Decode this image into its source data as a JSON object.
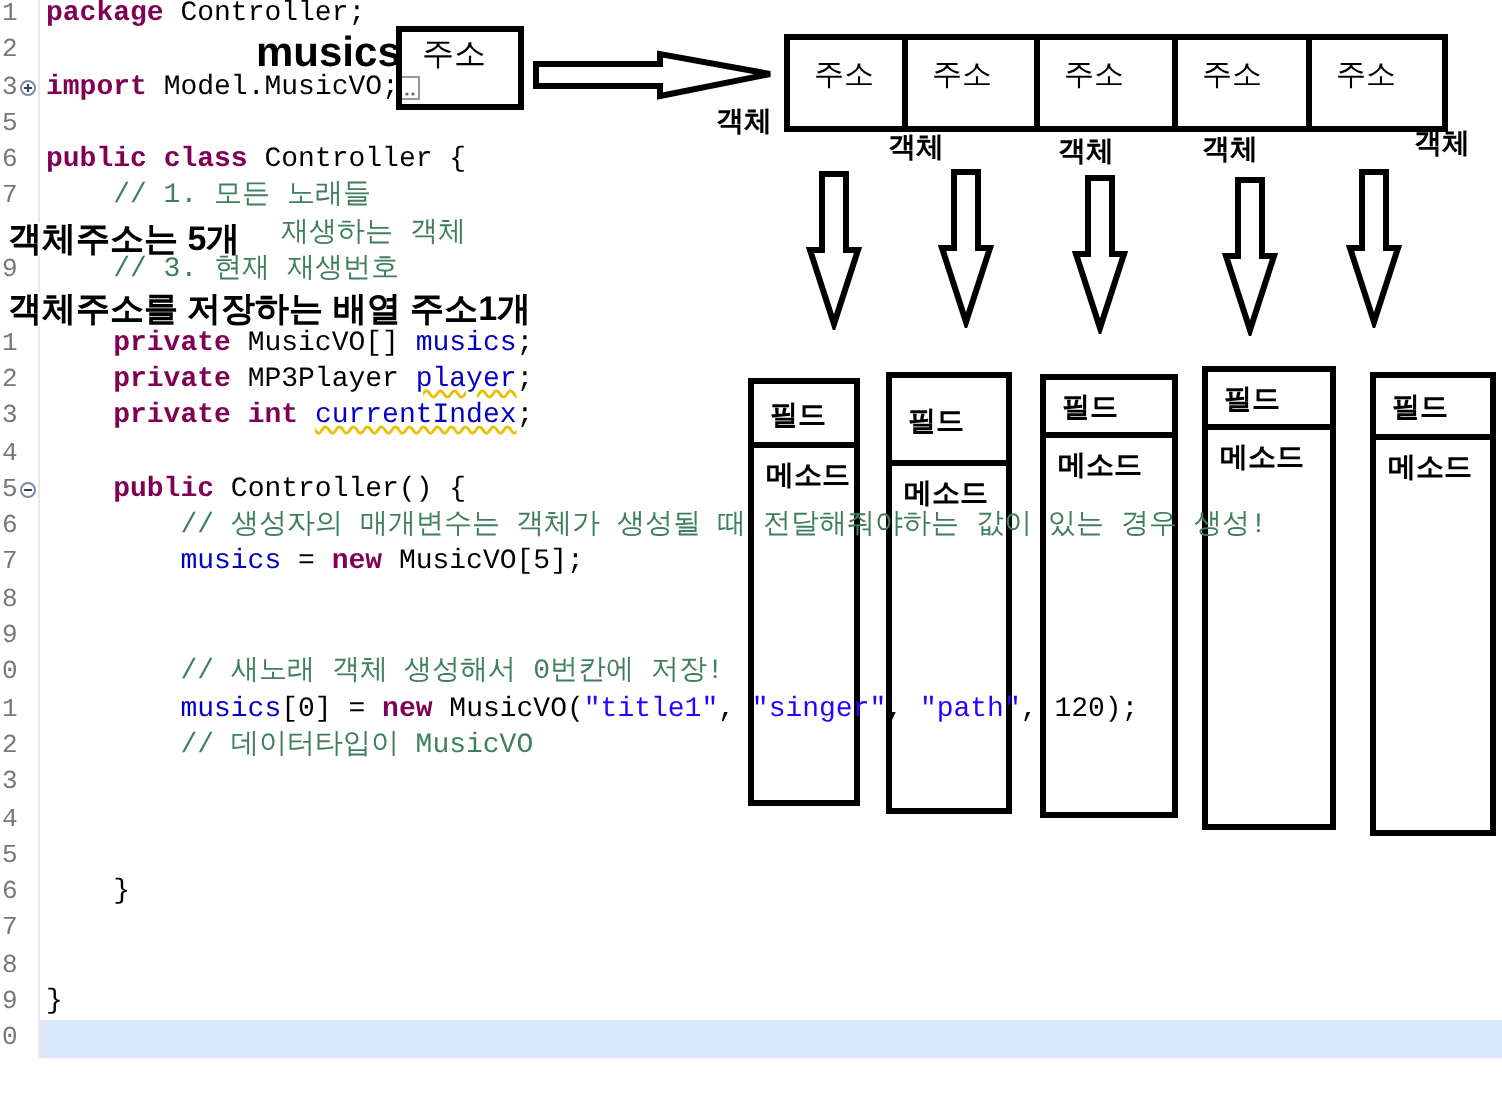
{
  "editor": {
    "lines": [
      {
        "number": "1",
        "current": false,
        "kind": "plain",
        "tokens": [
          {
            "kind": "keyword",
            "text": "package"
          },
          {
            "kind": "plain",
            "text": "Controller;"
          }
        ]
      },
      {
        "number": "2",
        "current": false,
        "kind": "plain"
      },
      {
        "number": "3",
        "current": false,
        "kind": "expandable",
        "tokens": [
          {
            "kind": "keyword",
            "text": "import"
          },
          {
            "kind": "plain",
            "text": "Model.MusicVO;"
          }
        ]
      },
      {
        "number": "5",
        "current": false,
        "kind": "plain"
      },
      {
        "number": "6",
        "current": false,
        "kind": "plain",
        "tokens": [
          {
            "kind": "keyword",
            "text": "public"
          },
          {
            "kind": "keyword",
            "text": "class"
          },
          {
            "kind": "plain",
            "text": "Controller {"
          }
        ]
      },
      {
        "number": "7",
        "current": false,
        "kind": "plain",
        "tokens": [
          {
            "kind": "comment",
            "text": "// 1. 모든 노래들"
          }
        ]
      },
      {
        "current": false,
        "kind": "plain",
        "tokens": [
          {
            "kind": "comment",
            "text": "재생하는 객체"
          }
        ]
      },
      {
        "number": "9",
        "current": false,
        "kind": "plain",
        "tokens": [
          {
            "kind": "comment",
            "text": "// 3. 현재 재생번호"
          }
        ]
      },
      {
        "current": false,
        "kind": "plain"
      },
      {
        "number": "1",
        "current": false,
        "kind": "plain",
        "tokens": [
          {
            "kind": "keyword",
            "text": "private"
          },
          {
            "kind": "plain",
            "text": "MusicVO[]"
          },
          {
            "kind": "field",
            "text": "musics"
          },
          {
            "kind": "punct",
            "text": ";"
          }
        ]
      },
      {
        "number": "2",
        "current": false,
        "kind": "plain",
        "tokens": [
          {
            "kind": "keyword",
            "text": "private"
          },
          {
            "kind": "plain",
            "text": "MP3Player"
          },
          {
            "kind": "flagged",
            "text": "player"
          },
          {
            "kind": "punct",
            "text": ";"
          }
        ]
      },
      {
        "number": "3",
        "current": false,
        "kind": "plain",
        "tokens": [
          {
            "kind": "keyword",
            "text": "private"
          },
          {
            "kind": "keyword",
            "text": "int"
          },
          {
            "kind": "flagged",
            "text": "currentIndex"
          },
          {
            "kind": "punct",
            "text": ";"
          }
        ]
      },
      {
        "number": "4",
        "current": false,
        "kind": "plain"
      },
      {
        "number": "5",
        "current": false,
        "kind": "collapsible",
        "tokens": [
          {
            "kind": "keyword",
            "text": "public"
          },
          {
            "kind": "plain",
            "text": "Controller() {"
          }
        ]
      },
      {
        "number": "6",
        "current": false,
        "kind": "plain",
        "tokens": [
          {
            "kind": "comment",
            "text": "// 생성자의 매개변수는 객체가 생성될 때 전달해줘야하는 값이 있는 경우 생성!"
          }
        ]
      },
      {
        "number": "7",
        "current": false,
        "kind": "plain",
        "tokens": [
          {
            "kind": "field",
            "text": "musics"
          },
          {
            "kind": "plain",
            "text": "="
          },
          {
            "kind": "keyword",
            "text": "new"
          },
          {
            "kind": "plain",
            "text": "MusicVO[5];"
          }
        ]
      },
      {
        "number": "8",
        "current": false,
        "kind": "plain"
      },
      {
        "number": "9",
        "current": false,
        "kind": "plain"
      },
      {
        "number": "0",
        "current": false,
        "kind": "plain",
        "tokens": [
          {
            "kind": "comment",
            "text": "// 새노래 객체 생성해서 0번칸에 저장!"
          }
        ]
      },
      {
        "number": "1",
        "current": false,
        "kind": "plain",
        "tokens": [
          {
            "kind": "field",
            "text": "musics"
          },
          {
            "kind": "punct",
            "text": "[0]"
          },
          {
            "kind": "plain",
            "text": "="
          },
          {
            "kind": "keyword",
            "text": "new"
          },
          {
            "kind": "plain",
            "text": "MusicVO("
          },
          {
            "kind": "string",
            "text": "\"title1\""
          },
          {
            "kind": "punct",
            "text": ","
          },
          {
            "kind": "string",
            "text": "\"singer\""
          },
          {
            "kind": "punct",
            "text": ","
          },
          {
            "kind": "string",
            "text": "\"path\""
          },
          {
            "kind": "punct",
            "text": ","
          },
          {
            "kind": "plain",
            "text": "120);"
          }
        ]
      },
      {
        "number": "2",
        "current": false,
        "kind": "plain",
        "tokens": [
          {
            "kind": "comment",
            "text": "// 데이터타입이 MusicVO"
          }
        ]
      },
      {
        "number": "3",
        "current": false,
        "kind": "plain"
      },
      {
        "number": "4",
        "current": false,
        "kind": "plain"
      },
      {
        "number": "5",
        "current": false,
        "kind": "plain"
      },
      {
        "number": "6",
        "current": false,
        "kind": "plain",
        "tokens": [
          {
            "kind": "plain",
            "text": "}"
          }
        ]
      },
      {
        "number": "7",
        "current": false,
        "kind": "plain"
      },
      {
        "number": "8",
        "current": false,
        "kind": "plain"
      },
      {
        "number": "9",
        "current": false,
        "kind": "plain",
        "tokens": [
          {
            "kind": "plain",
            "text": "}"
          }
        ]
      },
      {
        "number": "0",
        "current": true,
        "kind": "plain"
      }
    ]
  },
  "diagram": {
    "variable_label": "musics",
    "reference_box": "주소",
    "array_cells": [
      "주소",
      "주소",
      "주소",
      "주소",
      "주소"
    ],
    "object_labels": [
      "객체",
      "객체",
      "객체",
      "객체",
      "객체"
    ],
    "objects": [
      {
        "field": "필드",
        "method": "메소드"
      },
      {
        "field": "필드",
        "method": "메소드"
      },
      {
        "field": "필드",
        "method": "메소드"
      },
      {
        "field": "필드",
        "method": "메소드"
      },
      {
        "field": "필드",
        "method": "메소드"
      }
    ],
    "notes": [
      "객체주소는 5개",
      "객체주소를 저장하는 배열 주소1개"
    ]
  }
}
